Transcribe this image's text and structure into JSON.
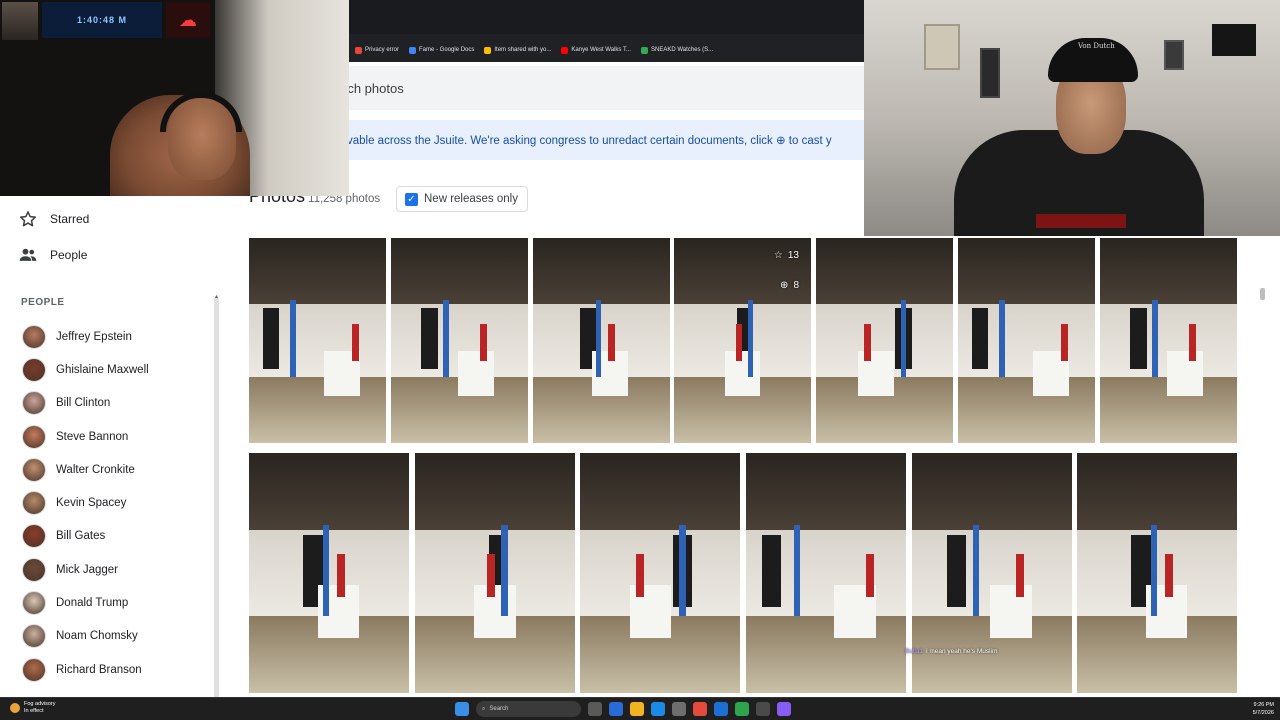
{
  "browser": {
    "bookmarks": [
      {
        "label": "Privacy error",
        "color": "#e8453c"
      },
      {
        "label": "Fame - Google Docs",
        "color": "#4285f4"
      },
      {
        "label": "Item shared with yo...",
        "color": "#fbbc04"
      },
      {
        "label": "Kanye West Walks T...",
        "color": "#ff0000"
      },
      {
        "label": "SNEAKD Watches (S...",
        "color": "#34a853"
      }
    ]
  },
  "search": {
    "placeholder": "rch photos"
  },
  "notice": {
    "text": "vable across the Jsuite. We're asking congress to unredact certain documents, click ⊕ to cast y"
  },
  "photos": {
    "title": "Photos",
    "count": "11,258 photos",
    "filter_label": "New releases only",
    "filter_checked": true
  },
  "sidebar": {
    "nav": [
      {
        "label": "Starred",
        "icon": "star-icon"
      },
      {
        "label": "People",
        "icon": "people-icon"
      }
    ],
    "people_heading": "PEOPLE",
    "people": [
      {
        "name": "Jeffrey Epstein",
        "tone": "#b67a62"
      },
      {
        "name": "Ghislaine Maxwell",
        "tone": "#7a3b2a"
      },
      {
        "name": "Bill Clinton",
        "tone": "#c9a59a"
      },
      {
        "name": "Steve Bannon",
        "tone": "#c47a5a"
      },
      {
        "name": "Walter Cronkite",
        "tone": "#c09070"
      },
      {
        "name": "Kevin Spacey",
        "tone": "#b58a6a"
      },
      {
        "name": "Bill Gates",
        "tone": "#8c3a2a"
      },
      {
        "name": "Mick Jagger",
        "tone": "#6a4a3a"
      },
      {
        "name": "Donald Trump",
        "tone": "#d8c8b8"
      },
      {
        "name": "Noam Chomsky",
        "tone": "#c8b0a0"
      },
      {
        "name": "Richard Branson",
        "tone": "#b06a4a"
      }
    ]
  },
  "photo_badges": {
    "stars": "13",
    "zoom": "8"
  },
  "stream": {
    "timer": "1:40:48 M"
  },
  "cam_right": {
    "cap_logo": "Von Dutch"
  },
  "chat": {
    "user": "Bulla1",
    "message": "i mean yeah he's Muslim"
  },
  "taskbar": {
    "weather_title": "Fog advisory",
    "weather_sub": "In effect",
    "search_label": "Search",
    "time": "9:26 PM",
    "date": "5/7/2026"
  }
}
